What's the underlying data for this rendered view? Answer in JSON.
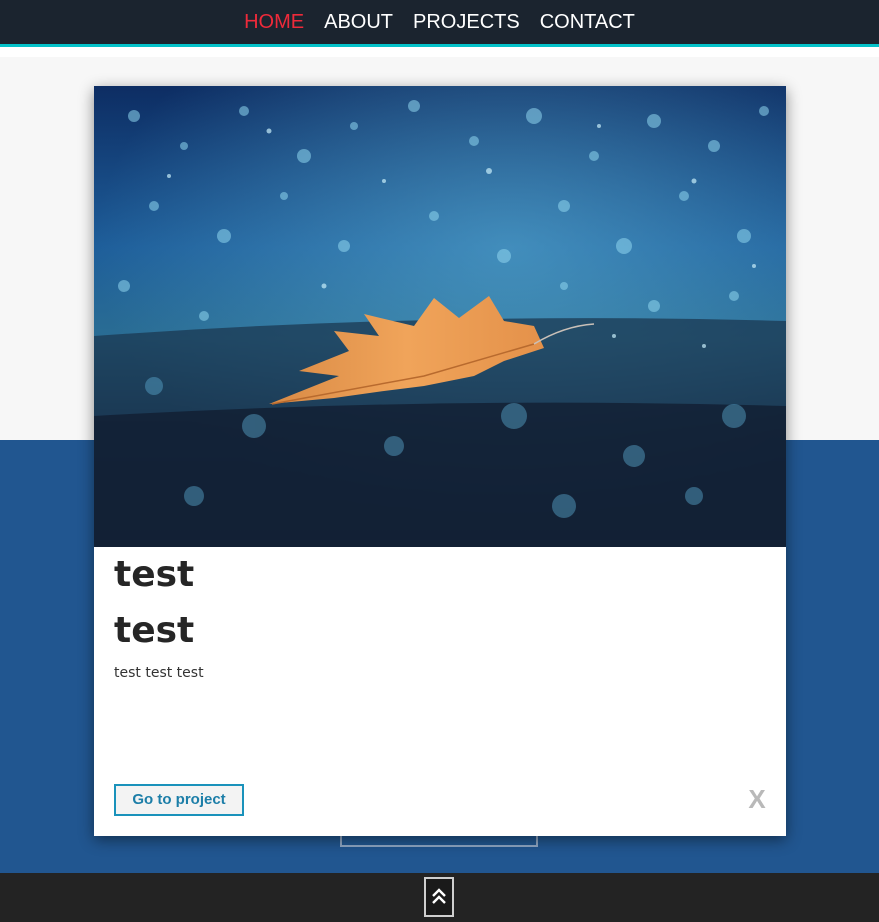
{
  "nav": {
    "items": [
      {
        "label": "HOME",
        "active": true
      },
      {
        "label": "ABOUT",
        "active": false
      },
      {
        "label": "PROJECTS",
        "active": false
      },
      {
        "label": "CONTACT",
        "active": false
      }
    ]
  },
  "modal": {
    "image": "autumn-leaf-on-wet-ground-with-blue-bokeh-photo",
    "title": "test",
    "subtitle": "test",
    "description": "test test test",
    "project_button_label": "Go to project",
    "close_label": "X"
  },
  "footer": {
    "scroll_top_icon": "double-chevron-up-icon"
  },
  "colors": {
    "navbar_bg": "#1b242f",
    "nav_accent": "#04c2c9",
    "active_nav": "#ee2a3a",
    "section_blue": "#215690",
    "footer_bg": "#232323",
    "button_border": "#1a92bb"
  }
}
